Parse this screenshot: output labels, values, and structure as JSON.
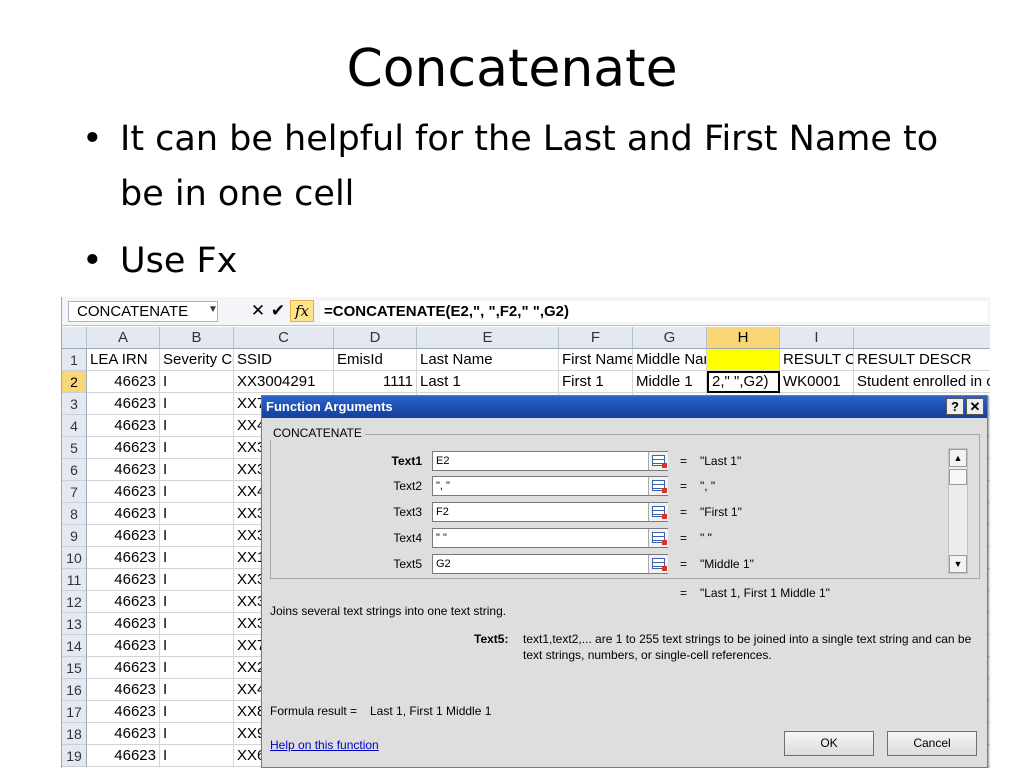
{
  "slide": {
    "title": "Concatenate",
    "bullets": [
      "It can be helpful for the Last and First Name to be in one cell",
      "Use Fx"
    ]
  },
  "excel": {
    "name_box": "CONCATENATE",
    "formula": "=CONCATENATE(E2,\", \",F2,\" \",G2)",
    "icons": {
      "cancel": "close-x",
      "enter": "checkmark",
      "fx": "insert-function"
    },
    "fx_label": "fx",
    "columns": [
      "A",
      "B",
      "C",
      "D",
      "E",
      "F",
      "G",
      "H",
      "I",
      ""
    ],
    "selected_column": "H",
    "rows": [
      {
        "num": "1",
        "cells": [
          "LEA IRN",
          "Severity Co",
          "SSID",
          "EmisId",
          "Last Name",
          "First Name",
          "Middle Name",
          "",
          "RESULT CO",
          "RESULT DESCR"
        ]
      },
      {
        "num": "2",
        "cells": [
          "46623",
          "I",
          "XX3004291",
          "1111",
          "Last 1",
          "First 1",
          "Middle 1",
          "2,\" \",G2)",
          "WK0001",
          "Student enrolled in o"
        ]
      },
      {
        "num": "3",
        "cells": [
          "46623",
          "I",
          "XX7"
        ]
      },
      {
        "num": "4",
        "cells": [
          "46623",
          "I",
          "XX4"
        ]
      },
      {
        "num": "5",
        "cells": [
          "46623",
          "I",
          "XX3"
        ]
      },
      {
        "num": "6",
        "cells": [
          "46623",
          "I",
          "XX3"
        ]
      },
      {
        "num": "7",
        "cells": [
          "46623",
          "I",
          "XX4"
        ]
      },
      {
        "num": "8",
        "cells": [
          "46623",
          "I",
          "XX3"
        ]
      },
      {
        "num": "9",
        "cells": [
          "46623",
          "I",
          "XX3"
        ]
      },
      {
        "num": "10",
        "cells": [
          "46623",
          "I",
          "XX1"
        ]
      },
      {
        "num": "11",
        "cells": [
          "46623",
          "I",
          "XX3"
        ]
      },
      {
        "num": "12",
        "cells": [
          "46623",
          "I",
          "XX3"
        ]
      },
      {
        "num": "13",
        "cells": [
          "46623",
          "I",
          "XX3"
        ]
      },
      {
        "num": "14",
        "cells": [
          "46623",
          "I",
          "XX7"
        ]
      },
      {
        "num": "15",
        "cells": [
          "46623",
          "I",
          "XX2"
        ]
      },
      {
        "num": "16",
        "cells": [
          "46623",
          "I",
          "XX4"
        ]
      },
      {
        "num": "17",
        "cells": [
          "46623",
          "I",
          "XX8"
        ]
      },
      {
        "num": "18",
        "cells": [
          "46623",
          "I",
          "XX9"
        ]
      },
      {
        "num": "19",
        "cells": [
          "46623",
          "I",
          "XX6"
        ]
      }
    ],
    "yellow_cell_color": "#ffff00"
  },
  "dialog": {
    "title": "Function Arguments",
    "help_btn": "?",
    "close_btn": "✕",
    "function_name": "CONCATENATE",
    "args": [
      {
        "label": "Text1",
        "value": "E2",
        "result": "\"Last 1\""
      },
      {
        "label": "Text2",
        "value": "\", \"",
        "result": "\", \""
      },
      {
        "label": "Text3",
        "value": "F2",
        "result": "\"First 1\""
      },
      {
        "label": "Text4",
        "value": "\" \"",
        "result": "\" \""
      },
      {
        "label": "Text5",
        "value": "G2",
        "result": "\"Middle 1\""
      }
    ],
    "eq": "=",
    "overall_result": "\"Last 1, First 1 Middle 1\"",
    "description": "Joins several text strings into one text string.",
    "arg_help_label": "Text5:",
    "arg_help_text_1": "text1,text2,... are 1 to 255 text strings to be joined into a single text string and can be",
    "arg_help_text_2": "text strings, numbers, or single-cell references.",
    "formula_result_label": "Formula result =",
    "formula_result_value": "Last 1, First 1 Middle 1",
    "help_link": "Help on this function",
    "ok": "OK",
    "cancel": "Cancel",
    "title_bar_color": "#1f4fb3"
  }
}
